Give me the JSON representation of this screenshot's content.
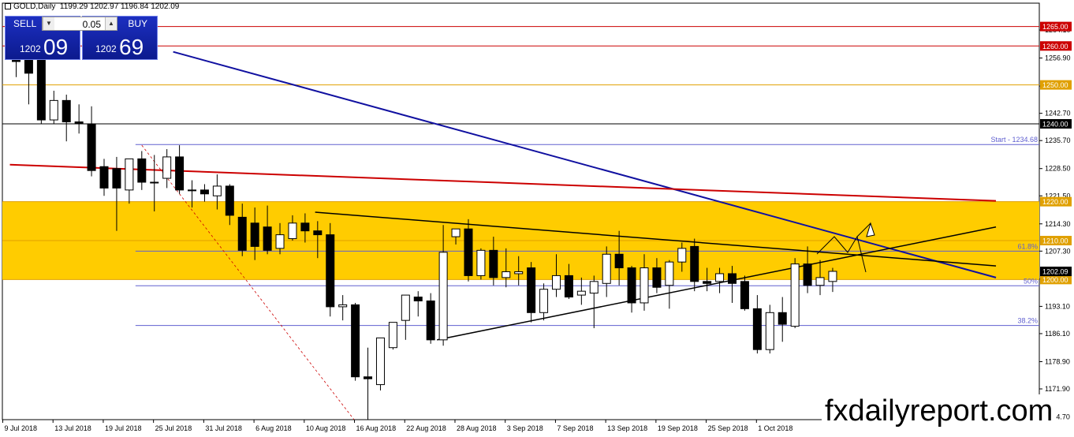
{
  "header": {
    "symbol": "GOLD,Daily",
    "ohlc": "1199.29 1202.97 1196.84 1202.09"
  },
  "trade_panel": {
    "sell_label": "SELL",
    "buy_label": "BUY",
    "lot_value": "0.05",
    "sell_small": "1202",
    "sell_big": "09",
    "buy_small": "1202",
    "buy_big": "69"
  },
  "watermark": "fxdailyreport.com",
  "colors": {
    "zone": "#ffcc00",
    "red_line": "#cc0000",
    "blue_line": "#1010a0",
    "fib_line": "#6060d0",
    "orange_line": "#e0a000",
    "candle_bear": "#000000",
    "candle_bull": "#ffffff"
  },
  "chart_data": {
    "type": "candlestick",
    "symbol": "GOLD",
    "timeframe": "Daily",
    "ylim": [
      1164,
      1271
    ],
    "y_ticks": [
      1264.1,
      1256.9,
      1249.7,
      1242.7,
      1235.7,
      1228.5,
      1221.5,
      1214.3,
      1207.3,
      1200.1,
      1193.1,
      1186.1,
      1178.9,
      1171.9,
      1164.7
    ],
    "x_tick_labels": [
      "9 Jul 2018",
      "13 Jul 2018",
      "19 Jul 2018",
      "25 Jul 2018",
      "31 Jul 2018",
      "6 Aug 2018",
      "10 Aug 2018",
      "16 Aug 2018",
      "22 Aug 2018",
      "28 Aug 2018",
      "3 Sep 2018",
      "7 Sep 2018",
      "13 Sep 2018",
      "19 Sep 2018",
      "25 Sep 2018",
      "1 Oct 2018"
    ],
    "x_tick_bars": [
      0,
      4,
      8,
      12,
      16,
      20,
      24,
      28,
      32,
      36,
      40,
      44,
      48,
      52,
      56,
      60
    ],
    "candles": [
      {
        "o": 1258.0,
        "h": 1262.5,
        "l": 1252.0,
        "c": 1256.0
      },
      {
        "o": 1257.0,
        "h": 1262.0,
        "l": 1245.0,
        "c": 1253.0
      },
      {
        "o": 1257.0,
        "h": 1260.0,
        "l": 1240.0,
        "c": 1241.0
      },
      {
        "o": 1241.0,
        "h": 1248.5,
        "l": 1240.0,
        "c": 1246.0
      },
      {
        "o": 1246.0,
        "h": 1247.5,
        "l": 1235.5,
        "c": 1240.5
      },
      {
        "o": 1240.5,
        "h": 1245.0,
        "l": 1237.5,
        "c": 1240.0
      },
      {
        "o": 1240.0,
        "h": 1244.5,
        "l": 1226.5,
        "c": 1228.0
      },
      {
        "o": 1229.0,
        "h": 1231.0,
        "l": 1221.5,
        "c": 1223.5
      },
      {
        "o": 1228.5,
        "h": 1231.5,
        "l": 1212.5,
        "c": 1223.5
      },
      {
        "o": 1223.0,
        "h": 1231.0,
        "l": 1219.5,
        "c": 1231.0
      },
      {
        "o": 1231.0,
        "h": 1233.0,
        "l": 1223.0,
        "c": 1225.0
      },
      {
        "o": 1225.0,
        "h": 1232.0,
        "l": 1217.5,
        "c": 1225.0
      },
      {
        "o": 1226.0,
        "h": 1233.5,
        "l": 1223.5,
        "c": 1231.5
      },
      {
        "o": 1231.5,
        "h": 1234.5,
        "l": 1222.0,
        "c": 1223.0
      },
      {
        "o": 1223.0,
        "h": 1225.5,
        "l": 1218.5,
        "c": 1223.0
      },
      {
        "o": 1223.0,
        "h": 1224.5,
        "l": 1220.0,
        "c": 1222.0
      },
      {
        "o": 1221.5,
        "h": 1227.0,
        "l": 1218.0,
        "c": 1224.0
      },
      {
        "o": 1224.0,
        "h": 1224.5,
        "l": 1214.0,
        "c": 1216.5
      },
      {
        "o": 1216.0,
        "h": 1219.5,
        "l": 1206.0,
        "c": 1207.5
      },
      {
        "o": 1214.5,
        "h": 1218.5,
        "l": 1205.0,
        "c": 1208.5
      },
      {
        "o": 1213.5,
        "h": 1219.0,
        "l": 1206.5,
        "c": 1207.5
      },
      {
        "o": 1208.0,
        "h": 1214.5,
        "l": 1206.5,
        "c": 1211.5
      },
      {
        "o": 1210.5,
        "h": 1216.5,
        "l": 1210.0,
        "c": 1214.5
      },
      {
        "o": 1214.5,
        "h": 1217.0,
        "l": 1209.5,
        "c": 1212.5
      },
      {
        "o": 1212.5,
        "h": 1215.0,
        "l": 1205.5,
        "c": 1211.5
      },
      {
        "o": 1211.5,
        "h": 1214.5,
        "l": 1190.5,
        "c": 1193.0
      },
      {
        "o": 1193.0,
        "h": 1196.0,
        "l": 1189.5,
        "c": 1193.5
      },
      {
        "o": 1193.5,
        "h": 1194.0,
        "l": 1174.0,
        "c": 1175.0
      },
      {
        "o": 1175.0,
        "h": 1182.5,
        "l": 1160.0,
        "c": 1174.5
      },
      {
        "o": 1173.0,
        "h": 1185.0,
        "l": 1171.5,
        "c": 1185.0
      },
      {
        "o": 1182.5,
        "h": 1189.0,
        "l": 1182.0,
        "c": 1189.0
      },
      {
        "o": 1189.5,
        "h": 1196.0,
        "l": 1184.5,
        "c": 1196.0
      },
      {
        "o": 1195.5,
        "h": 1197.0,
        "l": 1190.5,
        "c": 1194.5
      },
      {
        "o": 1194.5,
        "h": 1196.5,
        "l": 1183.5,
        "c": 1184.5
      },
      {
        "o": 1184.5,
        "h": 1214.0,
        "l": 1183.0,
        "c": 1207.0
      },
      {
        "o": 1211.0,
        "h": 1212.5,
        "l": 1209.0,
        "c": 1213.0
      },
      {
        "o": 1213.0,
        "h": 1215.5,
        "l": 1199.5,
        "c": 1201.0
      },
      {
        "o": 1201.0,
        "h": 1208.0,
        "l": 1200.0,
        "c": 1207.5
      },
      {
        "o": 1207.5,
        "h": 1211.0,
        "l": 1198.5,
        "c": 1200.5
      },
      {
        "o": 1200.5,
        "h": 1208.0,
        "l": 1198.0,
        "c": 1202.0
      },
      {
        "o": 1201.5,
        "h": 1206.0,
        "l": 1198.5,
        "c": 1202.0
      },
      {
        "o": 1203.0,
        "h": 1204.5,
        "l": 1189.0,
        "c": 1191.5
      },
      {
        "o": 1191.5,
        "h": 1199.0,
        "l": 1189.5,
        "c": 1197.5
      },
      {
        "o": 1197.5,
        "h": 1206.5,
        "l": 1195.5,
        "c": 1201.0
      },
      {
        "o": 1201.0,
        "h": 1204.0,
        "l": 1195.0,
        "c": 1195.5
      },
      {
        "o": 1196.0,
        "h": 1200.5,
        "l": 1193.5,
        "c": 1197.0
      },
      {
        "o": 1196.5,
        "h": 1201.0,
        "l": 1187.5,
        "c": 1199.5
      },
      {
        "o": 1199.0,
        "h": 1208.5,
        "l": 1195.5,
        "c": 1206.5
      },
      {
        "o": 1206.5,
        "h": 1212.5,
        "l": 1198.5,
        "c": 1203.0
      },
      {
        "o": 1203.0,
        "h": 1203.5,
        "l": 1191.5,
        "c": 1194.0
      },
      {
        "o": 1194.0,
        "h": 1206.5,
        "l": 1192.0,
        "c": 1203.0
      },
      {
        "o": 1203.0,
        "h": 1205.5,
        "l": 1196.5,
        "c": 1198.0
      },
      {
        "o": 1198.5,
        "h": 1205.0,
        "l": 1192.5,
        "c": 1204.5
      },
      {
        "o": 1204.5,
        "h": 1209.5,
        "l": 1202.0,
        "c": 1208.0
      },
      {
        "o": 1208.5,
        "h": 1210.5,
        "l": 1197.0,
        "c": 1199.5
      },
      {
        "o": 1199.5,
        "h": 1203.0,
        "l": 1197.0,
        "c": 1199.0
      },
      {
        "o": 1199.5,
        "h": 1203.0,
        "l": 1196.5,
        "c": 1201.5
      },
      {
        "o": 1201.5,
        "h": 1203.5,
        "l": 1194.0,
        "c": 1199.0
      },
      {
        "o": 1199.5,
        "h": 1201.0,
        "l": 1192.0,
        "c": 1192.5
      },
      {
        "o": 1192.5,
        "h": 1196.0,
        "l": 1181.0,
        "c": 1182.0
      },
      {
        "o": 1182.0,
        "h": 1193.5,
        "l": 1181.0,
        "c": 1191.5
      },
      {
        "o": 1191.5,
        "h": 1195.5,
        "l": 1184.0,
        "c": 1188.5
      },
      {
        "o": 1188.0,
        "h": 1205.5,
        "l": 1187.5,
        "c": 1204.0
      },
      {
        "o": 1204.0,
        "h": 1208.5,
        "l": 1196.5,
        "c": 1198.5
      },
      {
        "o": 1198.5,
        "h": 1205.0,
        "l": 1196.0,
        "c": 1200.5
      },
      {
        "o": 1199.5,
        "h": 1203.0,
        "l": 1196.8,
        "c": 1202.1
      }
    ],
    "horizontal_levels": [
      {
        "price": 1265.0,
        "label": "1265.00",
        "color": "#cc0000"
      },
      {
        "price": 1260.0,
        "label": "1260.00",
        "color": "#cc0000"
      },
      {
        "price": 1250.0,
        "label": "1250.00",
        "color": "#e0a000"
      },
      {
        "price": 1240.0,
        "label": "1240.00",
        "color": "#000000"
      },
      {
        "price": 1220.0,
        "label": "1220.00",
        "color": "#e0a000"
      },
      {
        "price": 1210.0,
        "label": "1210.00",
        "color": "#e0a000"
      },
      {
        "price": 1200.0,
        "label": "1200.00",
        "color": "#e0a000"
      }
    ],
    "current_price": {
      "price": 1202.09,
      "label": "1202.09"
    },
    "zone": {
      "top": 1220,
      "bottom": 1200
    },
    "fibonacci": {
      "start_label": "Start - 1234.68",
      "levels": [
        {
          "price": 1234.68,
          "label": ""
        },
        {
          "price": 1207.3,
          "label": "61.8%"
        },
        {
          "price": 1198.4,
          "label": "50%"
        },
        {
          "price": 1188.2,
          "label": "38.2%"
        },
        {
          "price": 1161.7,
          "label": ""
        }
      ]
    },
    "trendlines": [
      {
        "name": "blue-downtrend",
        "color": "#1010a0",
        "from": {
          "bar": 12.5,
          "price": 1258.5
        },
        "to": {
          "bar": 78,
          "price": 1200.5
        }
      },
      {
        "name": "red-trend",
        "color": "#cc0000",
        "from": {
          "bar": -0.5,
          "price": 1229.5
        },
        "to": {
          "bar": 78,
          "price": 1220.2
        }
      },
      {
        "name": "black-resistance",
        "color": "#000000",
        "from": {
          "bar": 23.8,
          "price": 1217.3
        },
        "to": {
          "bar": 78,
          "price": 1203.5
        }
      },
      {
        "name": "black-support",
        "color": "#000000",
        "from": {
          "bar": 33.5,
          "price": 1184.5
        },
        "to": {
          "bar": 78,
          "price": 1213.5
        }
      },
      {
        "name": "red-dashed",
        "color": "#cc0000",
        "from": {
          "bar": 10,
          "price": 1234.5
        },
        "to": {
          "bar": 27.5,
          "price": 1161.5
        }
      }
    ]
  }
}
